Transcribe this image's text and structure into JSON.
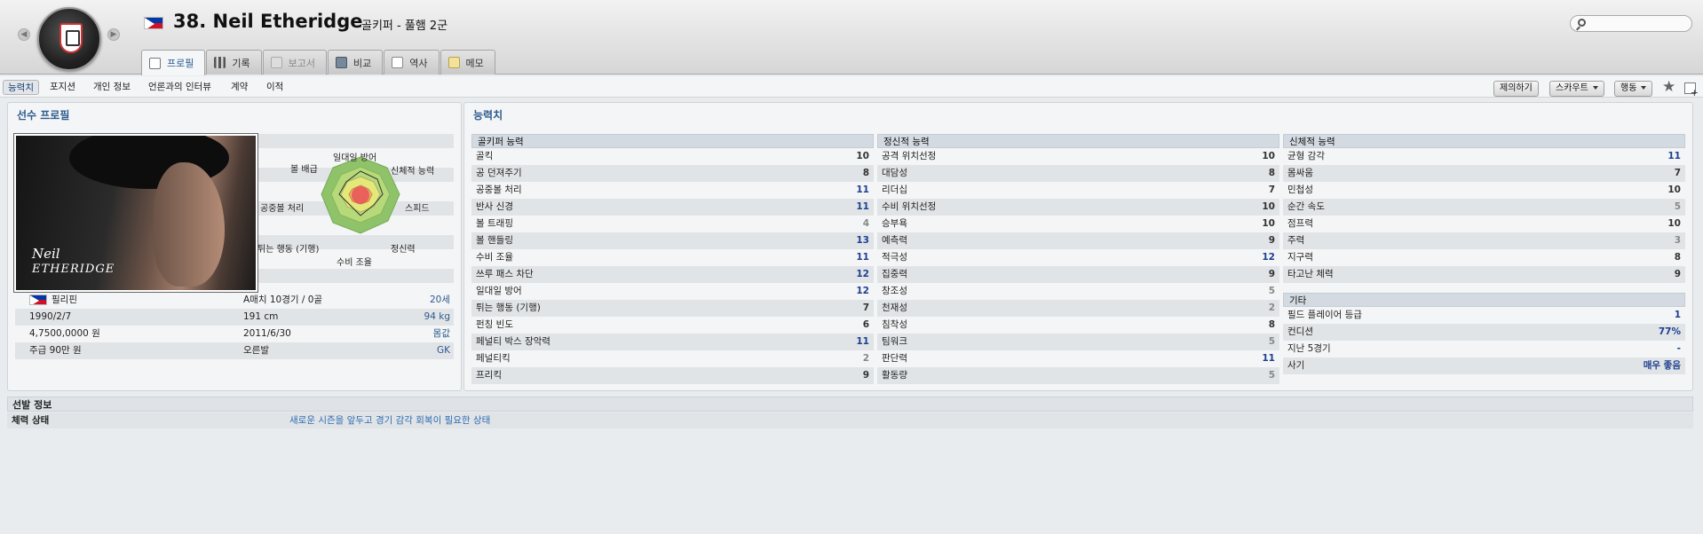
{
  "header": {
    "player_name": "38. Neil Etheridge",
    "player_subtitle": "골키퍼 - 풀햄 2군",
    "nationality_flag": "philippines-flag",
    "club_badge": "fulham-badge",
    "search_placeholder": ""
  },
  "tabs": [
    {
      "label": "프로필",
      "icon": "profile-icon",
      "active": true
    },
    {
      "label": "기록",
      "icon": "stats-icon",
      "active": false
    },
    {
      "label": "보고서",
      "icon": "report-icon",
      "active": false,
      "disabled": true
    },
    {
      "label": "비교",
      "icon": "compare-icon",
      "active": false
    },
    {
      "label": "역사",
      "icon": "history-icon",
      "active": false
    },
    {
      "label": "메모",
      "icon": "memo-icon",
      "active": false
    }
  ],
  "subnav": {
    "items": [
      "능력치",
      "포지션",
      "개인 정보",
      "언론과의 인터뷰",
      "계약",
      "이적"
    ],
    "active": "능력치"
  },
  "actions": {
    "offer_label": "제의하기",
    "scout_label": "스카우트",
    "action_label": "행동"
  },
  "profile": {
    "title": "선수 프로필",
    "signature": [
      "Neil",
      "ETHERIDGE"
    ],
    "radar_labels": {
      "top": "일대일 방어",
      "top_right": "신체적 능력",
      "right": "스피드",
      "bottom_right": "정신력",
      "bottom": "수비 조율",
      "bottom_left": "튀는 행동 (기행)",
      "left": "공중볼 처리",
      "top_left": "볼 배급"
    },
    "info_rows": [
      {
        "c1": "필리핀",
        "c2": "A매치 10경기 / 0골",
        "c3": "20세",
        "flag": true
      },
      {
        "c1": "1990/2/7",
        "c2": "191 cm",
        "c3": "94 kg"
      },
      {
        "c1": "4,7500,0000 원",
        "c2": "2011/6/30",
        "c3": "몸값"
      },
      {
        "c1": "주급 90만 원",
        "c2": "오른발",
        "c3": "GK"
      }
    ]
  },
  "abilities": {
    "title": "능력치",
    "goalkeeping": {
      "header": "골키퍼 능력",
      "rows": [
        {
          "label": "골킥",
          "value": "10"
        },
        {
          "label": "공 던져주기",
          "value": "8"
        },
        {
          "label": "공중볼 처리",
          "value": "11"
        },
        {
          "label": "반사 신경",
          "value": "11"
        },
        {
          "label": "볼 트래핑",
          "value": "4"
        },
        {
          "label": "볼 핸들링",
          "value": "13"
        },
        {
          "label": "수비 조율",
          "value": "11"
        },
        {
          "label": "쓰루 패스 차단",
          "value": "12"
        },
        {
          "label": "일대일 방어",
          "value": "12"
        },
        {
          "label": "튀는 행동 (기행)",
          "value": "7"
        },
        {
          "label": "펀칭 빈도",
          "value": "6"
        },
        {
          "label": "페널티 박스 장악력",
          "value": "11"
        },
        {
          "label": "페널티킥",
          "value": "2"
        },
        {
          "label": "프리킥",
          "value": "9"
        }
      ]
    },
    "mental": {
      "header": "정신적 능력",
      "rows": [
        {
          "label": "공격 위치선정",
          "value": "10"
        },
        {
          "label": "대담성",
          "value": "8"
        },
        {
          "label": "리더십",
          "value": "7"
        },
        {
          "label": "수비 위치선정",
          "value": "10"
        },
        {
          "label": "승부욕",
          "value": "10"
        },
        {
          "label": "예측력",
          "value": "9"
        },
        {
          "label": "적극성",
          "value": "12"
        },
        {
          "label": "집중력",
          "value": "9"
        },
        {
          "label": "창조성",
          "value": "5"
        },
        {
          "label": "천재성",
          "value": "2"
        },
        {
          "label": "침착성",
          "value": "8"
        },
        {
          "label": "팀워크",
          "value": "5"
        },
        {
          "label": "판단력",
          "value": "11"
        },
        {
          "label": "활동량",
          "value": "5"
        }
      ]
    },
    "physical": {
      "header": "신체적 능력",
      "rows": [
        {
          "label": "균형 감각",
          "value": "11"
        },
        {
          "label": "몸싸움",
          "value": "7"
        },
        {
          "label": "민첩성",
          "value": "10"
        },
        {
          "label": "순간 속도",
          "value": "5"
        },
        {
          "label": "점프력",
          "value": "10"
        },
        {
          "label": "주력",
          "value": "3"
        },
        {
          "label": "지구력",
          "value": "8"
        },
        {
          "label": "타고난 체력",
          "value": "9"
        }
      ]
    },
    "other": {
      "header": "기타",
      "rows": [
        {
          "label": "필드 플레이어 등급",
          "value": "1"
        },
        {
          "label": "컨디션",
          "value": "77%"
        },
        {
          "label": "지난 5경기",
          "value": "-"
        },
        {
          "label": "사기",
          "value": "매우 좋음"
        }
      ]
    }
  },
  "selection": {
    "header": "선발 정보",
    "row_label": "체력 상태",
    "row_value": "새로운 시즌을 앞두고 경기 감각 회복이 필요한 상태"
  },
  "colors": {
    "accent": "#2d5b8e",
    "high_value": "#1d3f8f",
    "low_value": "#888888"
  }
}
